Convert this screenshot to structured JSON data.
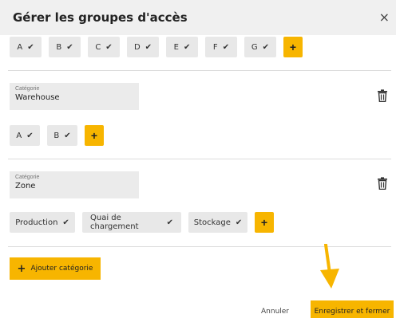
{
  "dialog": {
    "title": "Gérer les groupes d'accès",
    "close_symbol": "×"
  },
  "groups": [
    {
      "tags": [
        "A",
        "B",
        "C",
        "D",
        "E",
        "F",
        "G"
      ],
      "add_symbol": "+"
    },
    {
      "category_label": "Catégorie",
      "category_value": "Warehouse",
      "tags": [
        "A",
        "B"
      ],
      "add_symbol": "+"
    },
    {
      "category_label": "Catégorie",
      "category_value": "Zone",
      "tags": [
        "Production",
        "Quai de chargement",
        "Stockage"
      ],
      "add_symbol": "+"
    }
  ],
  "check_symbol": "✔",
  "add_category": {
    "plus": "+",
    "label": "Ajouter catégorie"
  },
  "footer": {
    "cancel_label": "Annuler",
    "save_label": "Enregistrer et fermer"
  },
  "colors": {
    "accent": "#f7b500",
    "chip_bg": "#e8e8e8",
    "header_bg": "#f0f0f0"
  },
  "icons": {
    "trash": "trash-icon",
    "arrow": "arrow-down-icon"
  }
}
